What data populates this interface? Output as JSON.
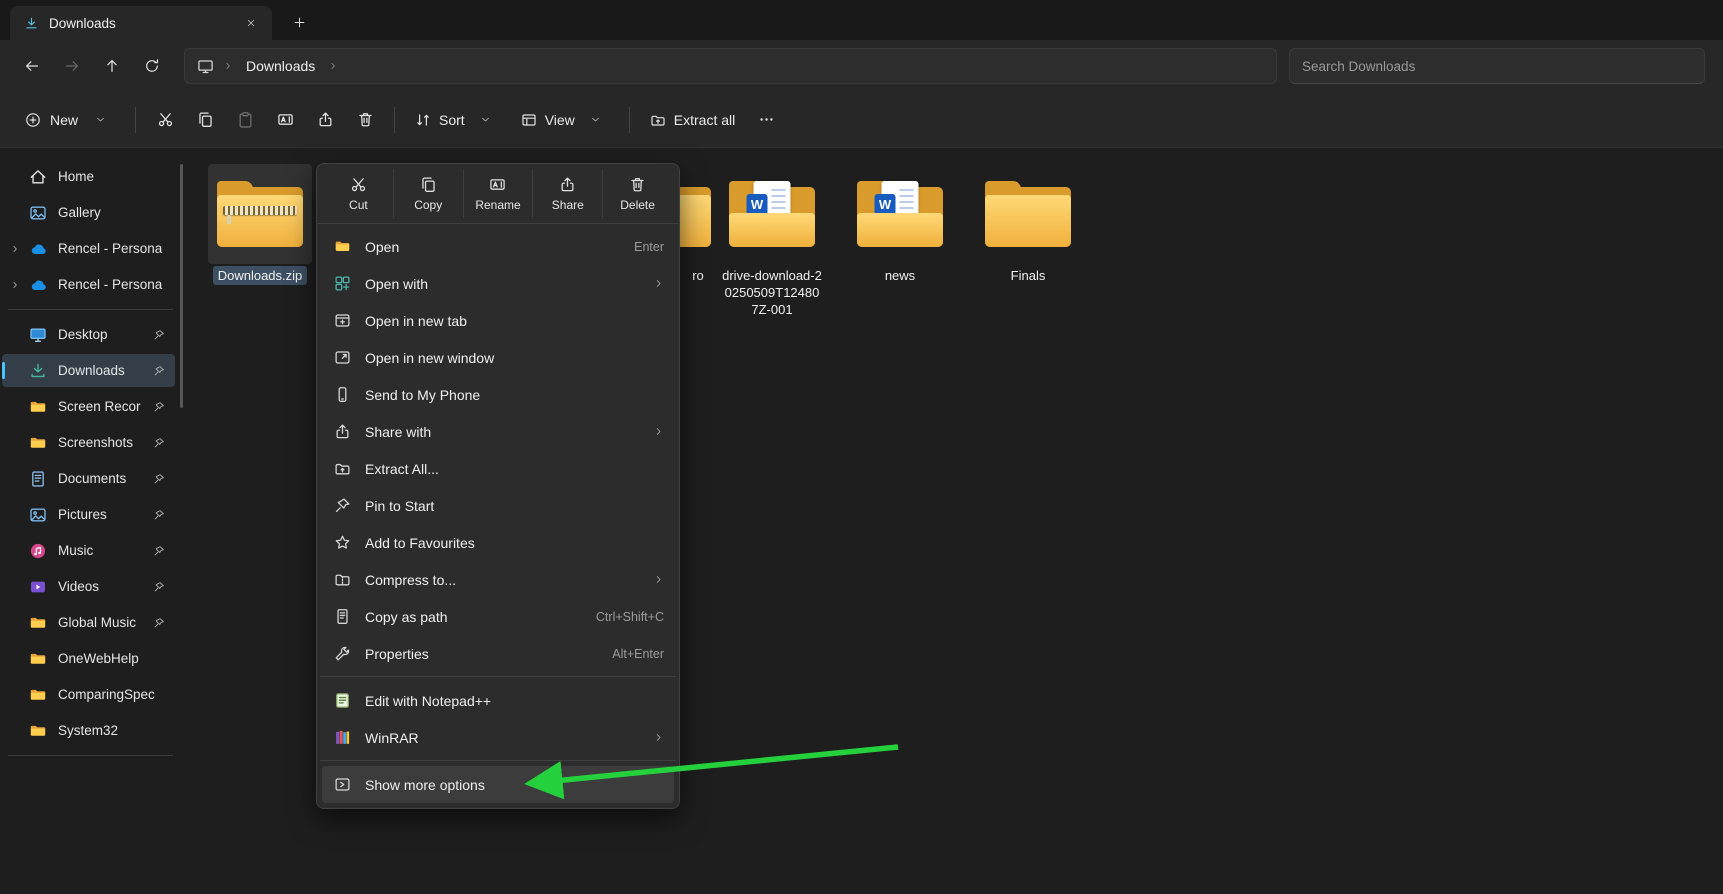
{
  "colors": {
    "arrow_green": "#24d13c",
    "folder_yellow": "#efb03c",
    "onedrive_blue": "#1a8fe3"
  },
  "tabbar": {
    "tab_title": "Downloads"
  },
  "navbar": {
    "breadcrumb_items": [
      "Downloads"
    ],
    "search_placeholder": "Search Downloads"
  },
  "toolbar": {
    "new_label": "New",
    "sort_label": "Sort",
    "view_label": "View",
    "extract_all_label": "Extract all",
    "icon_buttons": [
      {
        "name": "cut",
        "icon": "cut"
      },
      {
        "name": "copy",
        "icon": "copy"
      },
      {
        "name": "paste",
        "icon": "paste",
        "disabled": true
      },
      {
        "name": "rename",
        "icon": "rename"
      },
      {
        "name": "share",
        "icon": "share"
      },
      {
        "name": "delete",
        "icon": "delete"
      }
    ]
  },
  "sidebar": {
    "items": [
      {
        "label": "Home",
        "icon": "home"
      },
      {
        "label": "Gallery",
        "icon": "gallery"
      },
      {
        "label": "Rencel - Persona",
        "icon": "onedrive",
        "expandable": true
      },
      {
        "label": "Rencel - Persona",
        "icon": "onedrive",
        "expandable": true
      },
      {
        "divider": true
      },
      {
        "label": "Desktop",
        "icon": "desktop",
        "pinned": true
      },
      {
        "label": "Downloads",
        "icon": "downloads",
        "pinned": true,
        "selected": true
      },
      {
        "label": "Screen Recor",
        "icon": "folder",
        "pinned": true
      },
      {
        "label": "Screenshots",
        "icon": "folder",
        "pinned": true
      },
      {
        "label": "Documents",
        "icon": "documents",
        "pinned": true
      },
      {
        "label": "Pictures",
        "icon": "pictures",
        "pinned": true
      },
      {
        "label": "Music",
        "icon": "music",
        "pinned": true
      },
      {
        "label": "Videos",
        "icon": "videos",
        "pinned": true
      },
      {
        "label": "Global Music",
        "icon": "folder",
        "pinned": true
      },
      {
        "label": "OneWebHelp",
        "icon": "folder"
      },
      {
        "label": "ComparingSpec",
        "icon": "folder"
      },
      {
        "label": "System32",
        "icon": "folder"
      },
      {
        "divider": true
      }
    ]
  },
  "files": [
    {
      "name": "Downloads.zip",
      "type": "zip",
      "selected": true,
      "grid_col": 0
    },
    {
      "name": "ro",
      "type": "folder",
      "grid_col": 3,
      "peek": true
    },
    {
      "name": "drive-download-20250509T124807Z-001",
      "type": "word-folder",
      "grid_col": 4
    },
    {
      "name": "news",
      "type": "word-folder",
      "grid_col": 5
    },
    {
      "name": "Finals",
      "type": "folder",
      "grid_col": 6
    }
  ],
  "context_menu": {
    "quick_actions": [
      {
        "label": "Cut",
        "icon": "cut"
      },
      {
        "label": "Copy",
        "icon": "copy"
      },
      {
        "label": "Rename",
        "icon": "rename"
      },
      {
        "label": "Share",
        "icon": "share"
      },
      {
        "label": "Delete",
        "icon": "delete"
      }
    ],
    "items": [
      {
        "label": "Open",
        "icon": "open",
        "shortcut": "Enter"
      },
      {
        "label": "Open with",
        "icon": "open-with",
        "submenu": true
      },
      {
        "label": "Open in new tab",
        "icon": "new-tab"
      },
      {
        "label": "Open in new window",
        "icon": "new-window"
      },
      {
        "label": "Send to My Phone",
        "icon": "phone"
      },
      {
        "label": "Share with",
        "icon": "share",
        "submenu": true
      },
      {
        "label": "Extract All...",
        "icon": "extract"
      },
      {
        "label": "Pin to Start",
        "icon": "pin-start"
      },
      {
        "label": "Add to Favourites",
        "icon": "star"
      },
      {
        "label": "Compress to...",
        "icon": "compress",
        "submenu": true
      },
      {
        "label": "Copy as path",
        "icon": "copy-path",
        "shortcut": "Ctrl+Shift+C"
      },
      {
        "label": "Properties",
        "icon": "properties",
        "shortcut": "Alt+Enter"
      },
      {
        "divider": true
      },
      {
        "label": "Edit with Notepad++",
        "icon": "notepad"
      },
      {
        "label": "WinRAR",
        "icon": "winrar",
        "submenu": true
      },
      {
        "divider": true
      },
      {
        "label": "Show more options",
        "icon": "show-more",
        "highlighted": true
      }
    ]
  }
}
